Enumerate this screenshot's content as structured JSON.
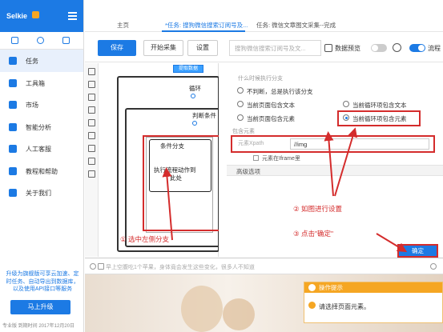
{
  "sidebar": {
    "brand": "Selkie",
    "items": [
      {
        "label": "任务",
        "active": true
      },
      {
        "label": "工具箱"
      },
      {
        "label": "市场"
      },
      {
        "label": "智能分析"
      },
      {
        "label": "人工客服"
      },
      {
        "label": "教程和帮助"
      },
      {
        "label": "关于我们"
      }
    ],
    "promo": "升级为旗舰版可享云加速、定时任务、自动导出到数据库，以及使用API接口等服务",
    "upgrade_label": "马上升级",
    "footer": "专业版 到期时间 2017年12月20日"
  },
  "tabs": [
    {
      "label": "主页"
    },
    {
      "label": "*任务: 搜狗微信搜索订阅号及..."
    },
    {
      "label": "任务: 微信文章图文采集--完成"
    }
  ],
  "toolbar": {
    "save_label": "保存",
    "collect_label": "开始采集",
    "settings_label": "设置",
    "search_placeholder": "搜狗微信搜索订阅号及文...",
    "preview_label": "数据预览",
    "flow_label": "流程"
  },
  "canvas": {
    "extract_label": "提取数据",
    "loop_label": "循环",
    "condition_label": "判断条件",
    "branch_title": "条件分支",
    "branch_body_line1": "执行流程动作到",
    "branch_body_line2": "此处"
  },
  "panel": {
    "title": "什么时候执行分支",
    "options": [
      {
        "label": "不判断，总是执行该分支",
        "selected": false
      },
      {
        "label": "当前页面包含文本",
        "selected": false
      },
      {
        "label": "当前循环项包含文本",
        "selected": false
      },
      {
        "label": "当前页面包含元素",
        "selected": false
      },
      {
        "label": "当前循环项包含元素",
        "selected": true
      }
    ],
    "contain_title": "包含元素",
    "xpath_label": "元素Xpath",
    "xpath_value": "//img",
    "iframe_label": "元素在Iframe里",
    "advanced_label": "高级选项",
    "ok_label": "确定"
  },
  "annotations": {
    "step1": "① 选中左侧分支",
    "step2": "② 如图进行设置",
    "step3": "③ 点击\"确定\""
  },
  "browser": {
    "address_text": "早上空腹吃1个苹果，身体竟会发生这些变化，很多人不知道"
  },
  "tip": {
    "title": "操作提示",
    "message": "请选择页面元素。"
  },
  "colors": {
    "accent": "#1c7ae4",
    "annotation": "#d42c2c",
    "warning": "#f5a623"
  }
}
